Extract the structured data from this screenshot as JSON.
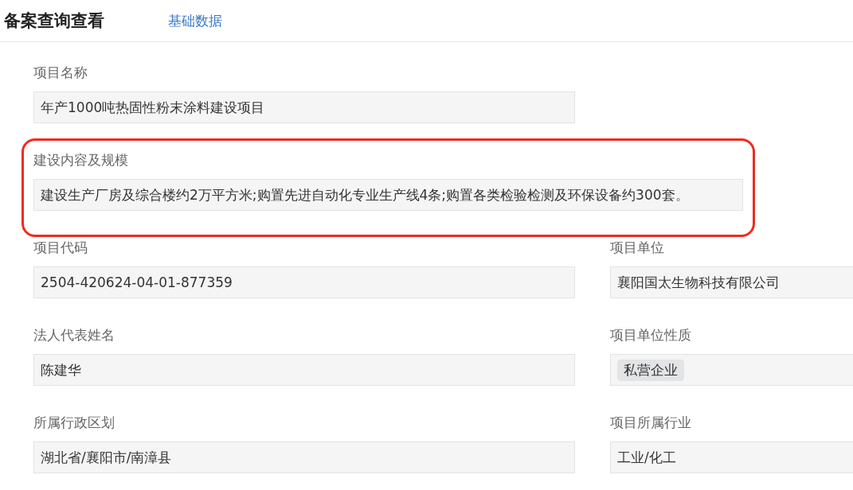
{
  "header": {
    "title": "备案查询查看",
    "tabs": [
      {
        "label": "基础数据",
        "selected": false
      }
    ]
  },
  "rows": [
    [
      {
        "label": "项目名称",
        "value": "年产1000吨热固性粉末涂料建设项目",
        "kind": "text",
        "highlighted": false
      }
    ],
    [
      {
        "label": "建设内容及规模",
        "value": "建设生产厂房及综合楼约2万平方米;购置先进自动化专业生产线4条;购置各类检验检测及环保设备约300套。",
        "kind": "text",
        "highlighted": true
      }
    ],
    [
      {
        "label": "项目代码",
        "value": "2504-420624-04-01-877359",
        "kind": "text",
        "highlighted": false
      },
      {
        "label": "项目单位",
        "value": "襄阳国太生物科技有限公司",
        "kind": "text",
        "highlighted": false
      }
    ],
    [
      {
        "label": "法人代表姓名",
        "value": "陈建华",
        "kind": "text",
        "highlighted": false
      },
      {
        "label": "项目单位性质",
        "value": "私营企业",
        "kind": "tag",
        "highlighted": false
      }
    ],
    [
      {
        "label": "所属行政区划",
        "value": "湖北省/襄阳市/南漳县",
        "kind": "text",
        "highlighted": false
      },
      {
        "label": "项目所属行业",
        "value": "工业/化工",
        "kind": "text",
        "highlighted": false
      }
    ]
  ]
}
